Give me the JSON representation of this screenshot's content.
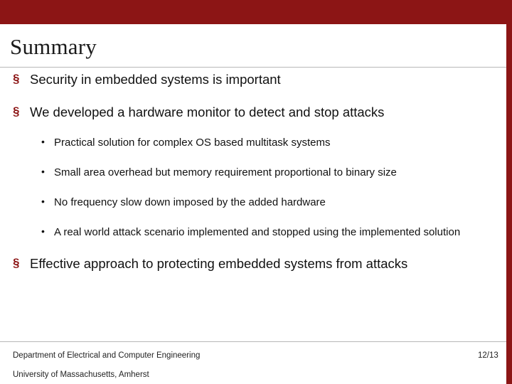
{
  "theme": {
    "accent": "#8c1515",
    "text": "#111111",
    "rule": "#b8b8b8",
    "background": "#ffffff"
  },
  "slide": {
    "title": "Summary",
    "bullets_level1": [
      "Security in embedded systems is important",
      "We developed a hardware monitor to detect and stop attacks",
      "Effective approach to protecting embedded systems from attacks"
    ],
    "bullets_level2": [
      "Practical solution for complex OS based multitask systems",
      "Small area overhead but memory requirement proportional to binary size",
      "No frequency slow down imposed by the added hardware",
      "A real world attack scenario implemented and stopped using the implemented solution"
    ],
    "markers": {
      "level1": "§",
      "level2": "•"
    }
  },
  "footer": {
    "line1": "Department of Electrical and Computer Engineering",
    "line2": "University of Massachusetts, Amherst",
    "page_number": "12/13"
  }
}
